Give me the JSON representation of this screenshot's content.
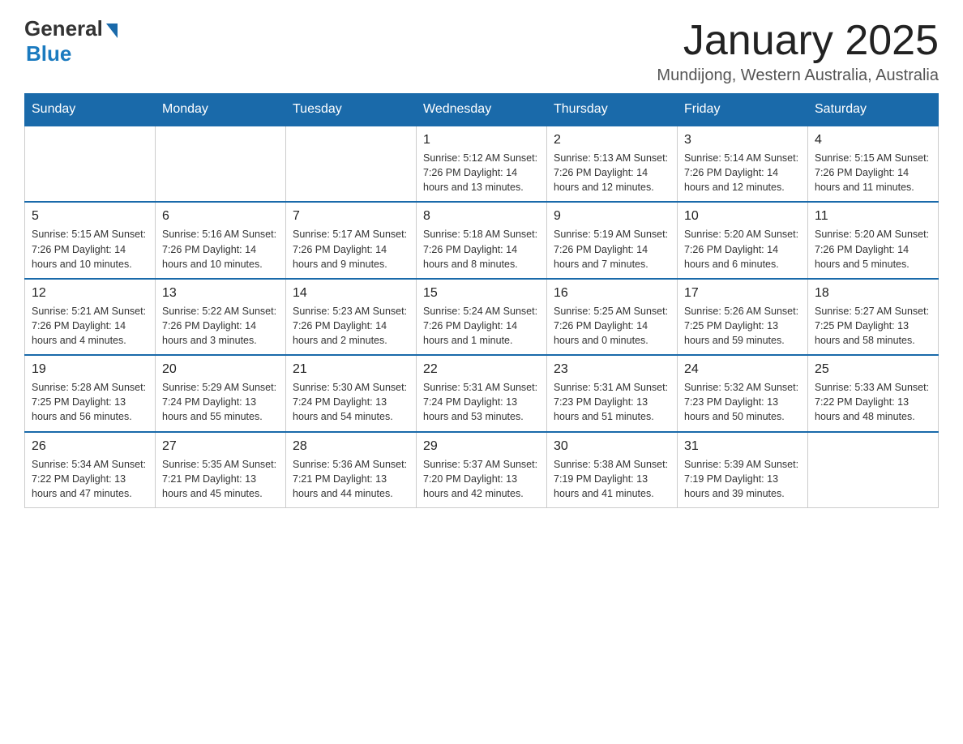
{
  "logo": {
    "general": "General",
    "blue": "Blue"
  },
  "title": "January 2025",
  "location": "Mundijong, Western Australia, Australia",
  "days_of_week": [
    "Sunday",
    "Monday",
    "Tuesday",
    "Wednesday",
    "Thursday",
    "Friday",
    "Saturday"
  ],
  "weeks": [
    [
      {
        "day": "",
        "info": ""
      },
      {
        "day": "",
        "info": ""
      },
      {
        "day": "",
        "info": ""
      },
      {
        "day": "1",
        "info": "Sunrise: 5:12 AM\nSunset: 7:26 PM\nDaylight: 14 hours\nand 13 minutes."
      },
      {
        "day": "2",
        "info": "Sunrise: 5:13 AM\nSunset: 7:26 PM\nDaylight: 14 hours\nand 12 minutes."
      },
      {
        "day": "3",
        "info": "Sunrise: 5:14 AM\nSunset: 7:26 PM\nDaylight: 14 hours\nand 12 minutes."
      },
      {
        "day": "4",
        "info": "Sunrise: 5:15 AM\nSunset: 7:26 PM\nDaylight: 14 hours\nand 11 minutes."
      }
    ],
    [
      {
        "day": "5",
        "info": "Sunrise: 5:15 AM\nSunset: 7:26 PM\nDaylight: 14 hours\nand 10 minutes."
      },
      {
        "day": "6",
        "info": "Sunrise: 5:16 AM\nSunset: 7:26 PM\nDaylight: 14 hours\nand 10 minutes."
      },
      {
        "day": "7",
        "info": "Sunrise: 5:17 AM\nSunset: 7:26 PM\nDaylight: 14 hours\nand 9 minutes."
      },
      {
        "day": "8",
        "info": "Sunrise: 5:18 AM\nSunset: 7:26 PM\nDaylight: 14 hours\nand 8 minutes."
      },
      {
        "day": "9",
        "info": "Sunrise: 5:19 AM\nSunset: 7:26 PM\nDaylight: 14 hours\nand 7 minutes."
      },
      {
        "day": "10",
        "info": "Sunrise: 5:20 AM\nSunset: 7:26 PM\nDaylight: 14 hours\nand 6 minutes."
      },
      {
        "day": "11",
        "info": "Sunrise: 5:20 AM\nSunset: 7:26 PM\nDaylight: 14 hours\nand 5 minutes."
      }
    ],
    [
      {
        "day": "12",
        "info": "Sunrise: 5:21 AM\nSunset: 7:26 PM\nDaylight: 14 hours\nand 4 minutes."
      },
      {
        "day": "13",
        "info": "Sunrise: 5:22 AM\nSunset: 7:26 PM\nDaylight: 14 hours\nand 3 minutes."
      },
      {
        "day": "14",
        "info": "Sunrise: 5:23 AM\nSunset: 7:26 PM\nDaylight: 14 hours\nand 2 minutes."
      },
      {
        "day": "15",
        "info": "Sunrise: 5:24 AM\nSunset: 7:26 PM\nDaylight: 14 hours\nand 1 minute."
      },
      {
        "day": "16",
        "info": "Sunrise: 5:25 AM\nSunset: 7:26 PM\nDaylight: 14 hours\nand 0 minutes."
      },
      {
        "day": "17",
        "info": "Sunrise: 5:26 AM\nSunset: 7:25 PM\nDaylight: 13 hours\nand 59 minutes."
      },
      {
        "day": "18",
        "info": "Sunrise: 5:27 AM\nSunset: 7:25 PM\nDaylight: 13 hours\nand 58 minutes."
      }
    ],
    [
      {
        "day": "19",
        "info": "Sunrise: 5:28 AM\nSunset: 7:25 PM\nDaylight: 13 hours\nand 56 minutes."
      },
      {
        "day": "20",
        "info": "Sunrise: 5:29 AM\nSunset: 7:24 PM\nDaylight: 13 hours\nand 55 minutes."
      },
      {
        "day": "21",
        "info": "Sunrise: 5:30 AM\nSunset: 7:24 PM\nDaylight: 13 hours\nand 54 minutes."
      },
      {
        "day": "22",
        "info": "Sunrise: 5:31 AM\nSunset: 7:24 PM\nDaylight: 13 hours\nand 53 minutes."
      },
      {
        "day": "23",
        "info": "Sunrise: 5:31 AM\nSunset: 7:23 PM\nDaylight: 13 hours\nand 51 minutes."
      },
      {
        "day": "24",
        "info": "Sunrise: 5:32 AM\nSunset: 7:23 PM\nDaylight: 13 hours\nand 50 minutes."
      },
      {
        "day": "25",
        "info": "Sunrise: 5:33 AM\nSunset: 7:22 PM\nDaylight: 13 hours\nand 48 minutes."
      }
    ],
    [
      {
        "day": "26",
        "info": "Sunrise: 5:34 AM\nSunset: 7:22 PM\nDaylight: 13 hours\nand 47 minutes."
      },
      {
        "day": "27",
        "info": "Sunrise: 5:35 AM\nSunset: 7:21 PM\nDaylight: 13 hours\nand 45 minutes."
      },
      {
        "day": "28",
        "info": "Sunrise: 5:36 AM\nSunset: 7:21 PM\nDaylight: 13 hours\nand 44 minutes."
      },
      {
        "day": "29",
        "info": "Sunrise: 5:37 AM\nSunset: 7:20 PM\nDaylight: 13 hours\nand 42 minutes."
      },
      {
        "day": "30",
        "info": "Sunrise: 5:38 AM\nSunset: 7:19 PM\nDaylight: 13 hours\nand 41 minutes."
      },
      {
        "day": "31",
        "info": "Sunrise: 5:39 AM\nSunset: 7:19 PM\nDaylight: 13 hours\nand 39 minutes."
      },
      {
        "day": "",
        "info": ""
      }
    ]
  ]
}
